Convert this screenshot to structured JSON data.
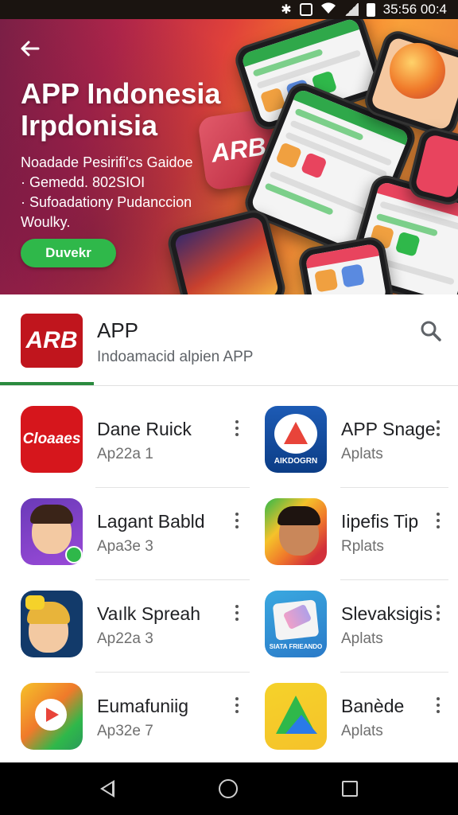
{
  "status_bar": {
    "time": "35:56 00:4"
  },
  "hero": {
    "back_icon": "arrow-back-icon",
    "title_line1": "APP Indonesia",
    "title_line2": "Irpdonisia",
    "desc_line1": "Noadade Pesirifi'cs Gaidoe",
    "desc_line2": "· Gemedd. 802SIOI",
    "desc_line3": "· Sufoadationy Pudanccion",
    "desc_line4": "Woulky.",
    "cta_label": "Duvekr",
    "logo_text": "ARB",
    "colors": {
      "cta": "#2fb84a",
      "gradient_start": "#7a1f46",
      "gradient_end": "#f57a2a"
    }
  },
  "app_header": {
    "logo_text": "ARB",
    "name": "APP",
    "subtitle": "Indoamacid alpien APP",
    "search_icon": "search-icon",
    "accent": "#2a8a3e"
  },
  "apps": [
    {
      "name": "Dane Ruick",
      "sub": "Ap22a 1",
      "icon": "red-logo-icon",
      "icon_text": "Cloaaes"
    },
    {
      "name": "APP Snage",
      "sub": "Aplats",
      "icon": "blue-triangle-icon",
      "icon_text": "AIKDOGRN"
    },
    {
      "name": "Lagant Babld",
      "sub": "Apa3e 3",
      "icon": "avatar-boy-icon"
    },
    {
      "name": "Iipefis Tip",
      "sub": "Rplats",
      "icon": "avatar-rainbow-icon"
    },
    {
      "name": "Vaılk Spreah",
      "sub": "Ap22a 3",
      "icon": "avatar-girl-icon"
    },
    {
      "name": "Slevaksigis",
      "sub": "Aplats",
      "icon": "eraser-icon",
      "icon_text": "SIATA FRIEANDO"
    },
    {
      "name": "Eumafuniig",
      "sub": "Ap32e 7",
      "icon": "play-bubble-icon"
    },
    {
      "name": "Banède",
      "sub": "Aplats",
      "icon": "drive-triangle-icon"
    }
  ],
  "nav_bar": {
    "back": "back-icon",
    "home": "home-icon",
    "recent": "recent-apps-icon"
  }
}
